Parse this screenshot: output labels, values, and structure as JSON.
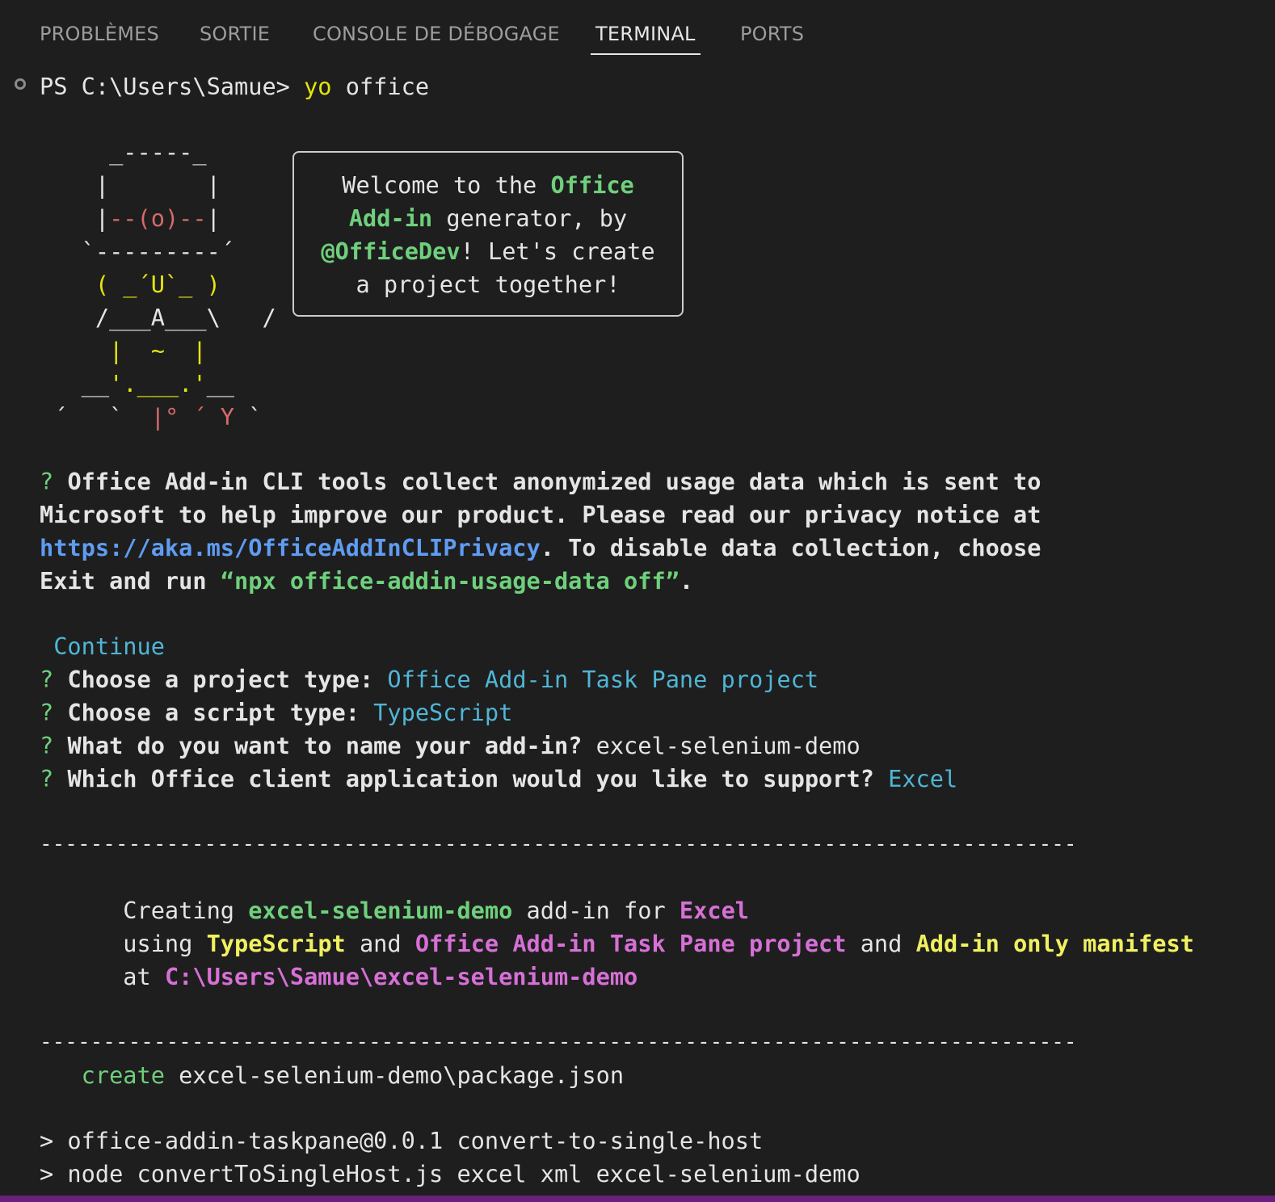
{
  "tabs": [
    {
      "label": "PROBLÈMES"
    },
    {
      "label": "SORTIE"
    },
    {
      "label": "CONSOLE DE DÉBOGAGE"
    },
    {
      "label": "TERMINAL"
    },
    {
      "label": "PORTS"
    }
  ],
  "prompt": {
    "ps": "PS C:\\Users\\Samue> ",
    "cmd_yo": "yo",
    "cmd_rest": " office"
  },
  "ascii": {
    "l1": "     _-----_     ",
    "l2": "    |       |    ",
    "l3_a": "    |",
    "l3_b": "--(o)--",
    "l3_c": "|    ",
    "l4": "   `---------´   ",
    "l5": "    ( _´U`_ )    ",
    "l6": "    /___A___\\   /",
    "l7": "     |  ~  |     ",
    "l8_a": "   __",
    "l8_b": "'.___.'",
    "l8_c": "__   ",
    "l9_a": " ´   `  ",
    "l9_b": "|° ´ Y",
    "l9_c": " ` "
  },
  "bubble": {
    "l1_a": "Welcome to the ",
    "l1_b": "Office",
    "l2_a": "Add-in",
    "l2_b": " generator, by",
    "l3_a": "@OfficeDev",
    "l3_b": "! Let's create",
    "l4": "a project together!"
  },
  "usage": {
    "q": "? ",
    "l1": "Office Add-in CLI tools collect anonymized usage data which is sent to",
    "l2": "Microsoft to help improve our product. Please read our privacy notice at",
    "link": "https://aka.ms/OfficeAddInCLIPrivacy",
    "l3_rest": ". To disable data collection, choose",
    "l4_a": "Exit and run ",
    "l4_b": "“npx office-addin-usage-data off”",
    "l4_c": "."
  },
  "answers": {
    "continue": " Continue",
    "q": "? ",
    "q1": "Choose a project type: ",
    "a1": "Office Add-in Task Pane project",
    "q2": "Choose a script type: ",
    "a2": "TypeScript",
    "q3": "What do you want to name your add-in? ",
    "a3": "excel-selenium-demo",
    "q4": "Which Office client application would you like to support? ",
    "a4": "Excel"
  },
  "separator": "----------------------------------------------------------------------------------",
  "creating": {
    "l1_a": "      Creating ",
    "l1_b": "excel-selenium-demo",
    "l1_c": " add-in for ",
    "l1_d": "Excel",
    "l2_a": "      using ",
    "l2_b": "TypeScript",
    "l2_c": " and ",
    "l2_d": "Office Add-in Task Pane project",
    "l2_e": " and ",
    "l2_f": "Add-in only manifest",
    "l3_a": "      at ",
    "l3_b": "C:\\Users\\Samue\\excel-selenium-demo"
  },
  "output": {
    "create_kw": "   create",
    "create_path": " excel-selenium-demo\\package.json",
    "npm1": "> office-addin-taskpane@0.0.1 convert-to-single-host",
    "npm2": "> node convertToSingleHost.js excel xml excel-selenium-demo"
  }
}
